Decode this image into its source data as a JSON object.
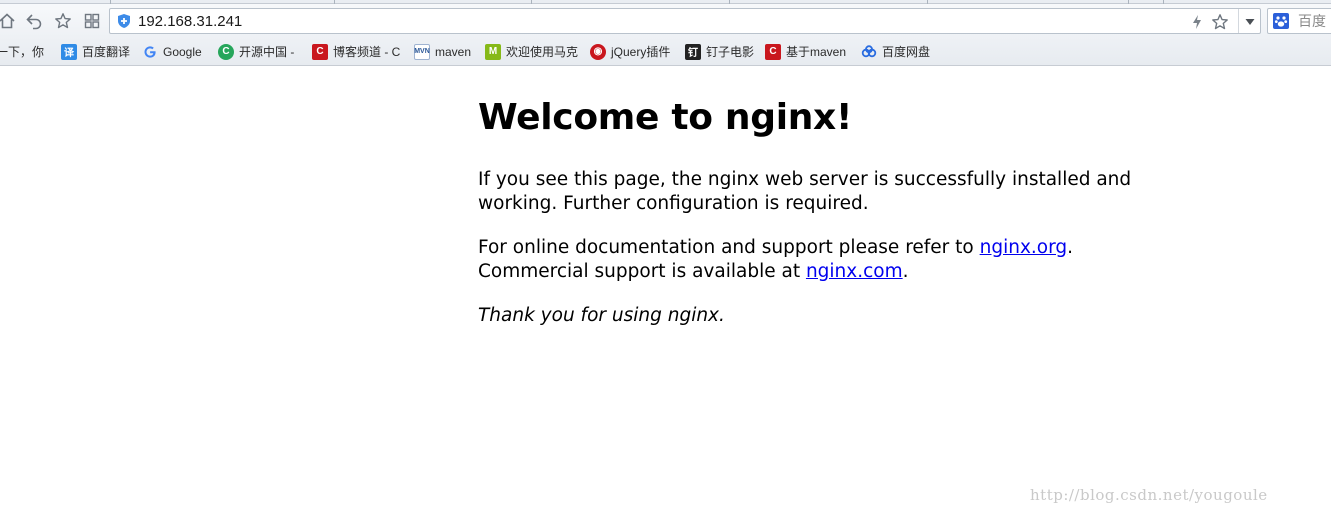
{
  "browser": {
    "address_bar": {
      "url": "192.168.31.241"
    },
    "search_box": {
      "placeholder": "百度"
    },
    "bookmarks": [
      {
        "label": "一下，你",
        "icon": "baidu-icon",
        "color": "#2b6de0"
      },
      {
        "label": "百度翻译",
        "icon": "translate-icon",
        "color": "#2f8be6"
      },
      {
        "label": "Google",
        "icon": "google-icon",
        "color": "#4285f4"
      },
      {
        "label": "开源中国 -",
        "icon": "oschina-icon",
        "color": "#26a65b"
      },
      {
        "label": "博客频道 - C",
        "icon": "csdn-icon",
        "color": "#c9171e"
      },
      {
        "label": "maven",
        "icon": "mvn-icon",
        "color": "#2b5797"
      },
      {
        "label": "欢迎使用马克",
        "icon": "markdown-icon",
        "color": "#86b918"
      },
      {
        "label": "jQuery插件",
        "icon": "jquery-icon",
        "color": "#c9171e"
      },
      {
        "label": "钉子电影",
        "icon": "movie-icon",
        "color": "#222222"
      },
      {
        "label": "基于maven",
        "icon": "csdn-icon",
        "color": "#c9171e"
      },
      {
        "label": "百度网盘",
        "icon": "cloud-disk-icon",
        "color": "#2b6de0"
      }
    ]
  },
  "page": {
    "heading": "Welcome to nginx!",
    "para1": "If you see this page, the nginx web server is successfully installed and working. Further configuration is required.",
    "para2_text1": "For online documentation and support please refer to ",
    "para2_link1": "nginx.org",
    "para2_text2": ".",
    "para2_text3": "Commercial support is available at ",
    "para2_link2": "nginx.com",
    "para2_text4": ".",
    "thanks": "Thank you for using nginx."
  },
  "watermark": "http://blog.csdn.net/yougoule"
}
